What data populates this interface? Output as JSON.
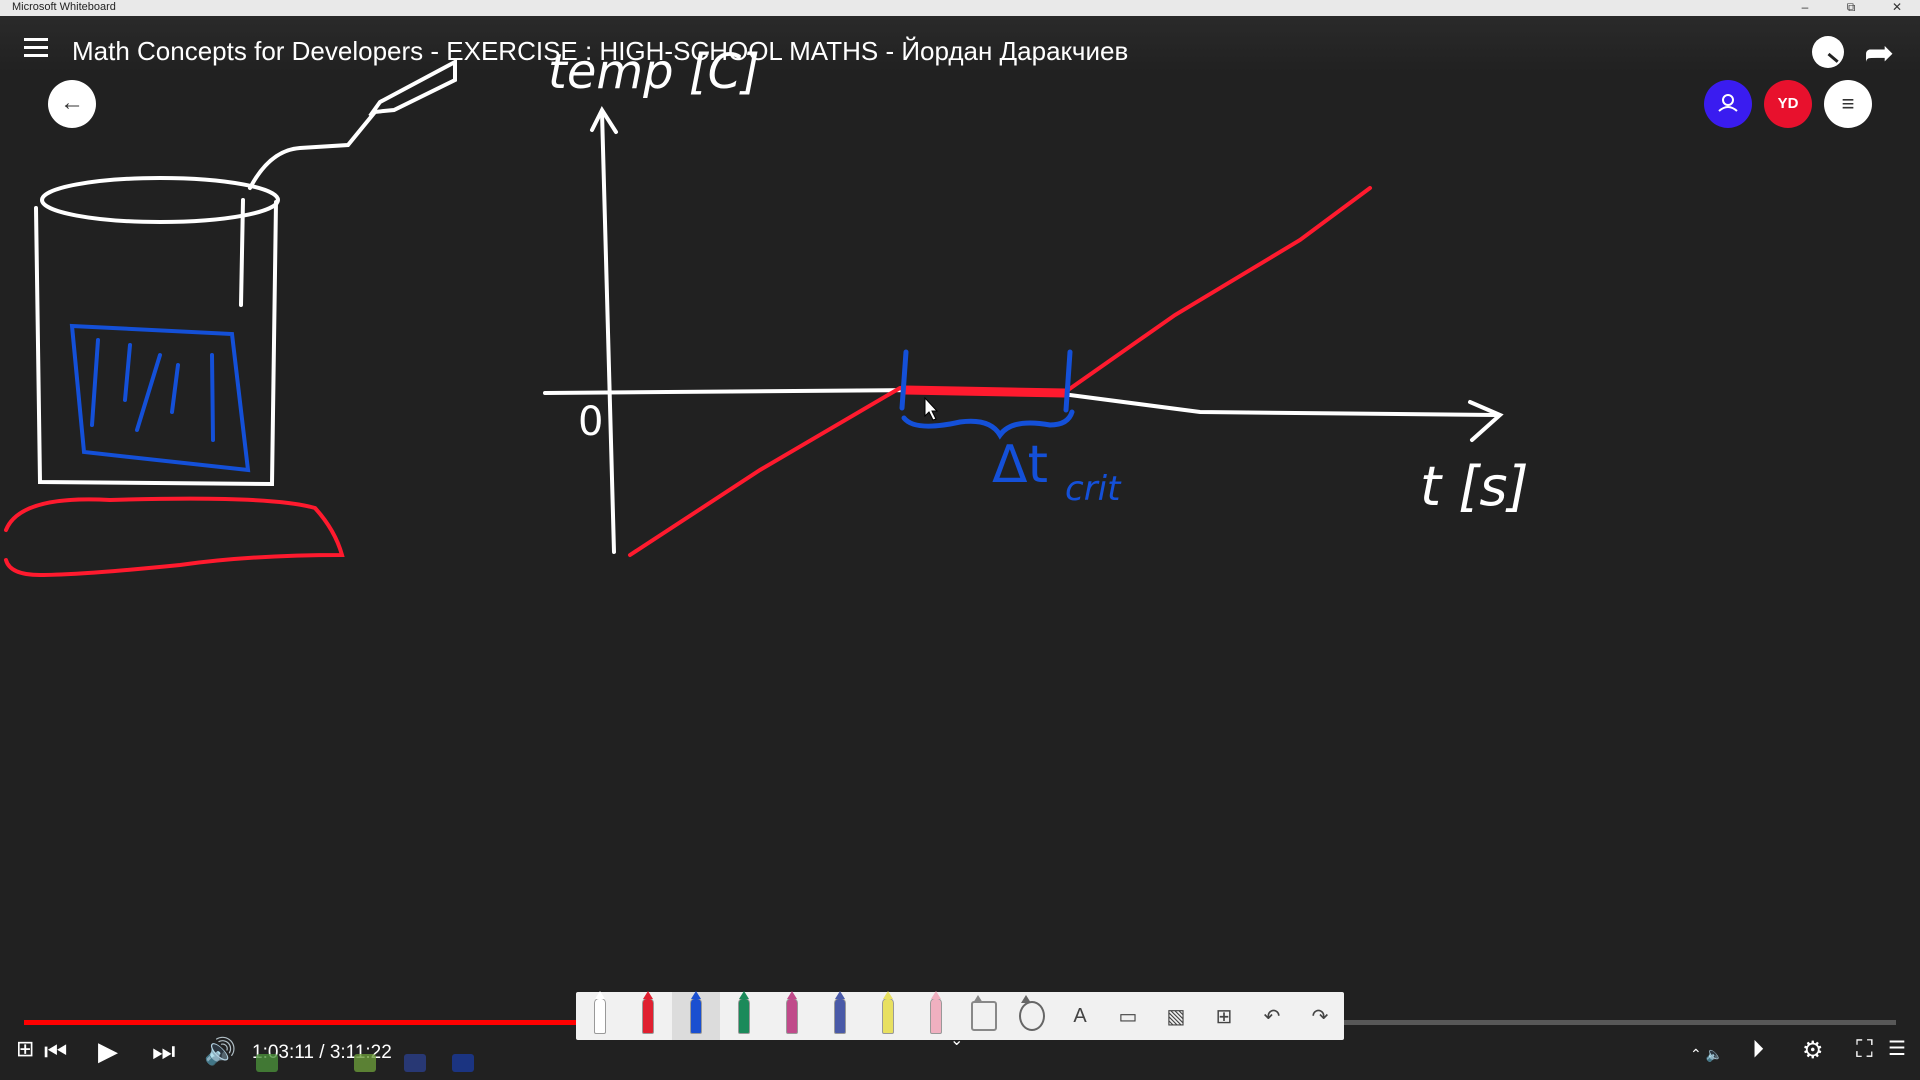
{
  "window": {
    "app_title": "Microsoft Whiteboard",
    "minimize": "–",
    "restore": "⧉",
    "close": "✕"
  },
  "player": {
    "video_title": "Math Concepts for Developers - EXERCISE : HIGH-SCHOOL MATHS - Йордан Даракчиев",
    "time_current": "1:03:11",
    "time_total": "3:11:22",
    "time_display": "1:03:11 / 3:11:22",
    "progress_fraction": 0.33,
    "colors": {
      "played": "#ff0000",
      "accent": "#ff0000"
    }
  },
  "whiteboard": {
    "avatar_initials": "YD",
    "colors": {
      "user_button": "#3a1cf0",
      "avatar": "#e8112d",
      "ink_white": "#ffffff",
      "ink_red": "#ff1a2e",
      "ink_blue": "#1450d8"
    },
    "board_text": {
      "y_axis": "temp [C]",
      "x_axis": "t [s]",
      "origin": "0",
      "delta": "Δt",
      "subscript": "crit"
    },
    "toolbar": [
      {
        "name": "pen-white-icon",
        "color": "#ffffff"
      },
      {
        "name": "pen-red-icon",
        "color": "#e02030"
      },
      {
        "name": "pen-blue-icon",
        "color": "#1a4fd0"
      },
      {
        "name": "pen-green-icon",
        "color": "#1b8a5a"
      },
      {
        "name": "pen-rainbow-icon",
        "color": "#c04a8a"
      },
      {
        "name": "pen-galaxy-icon",
        "color": "#4a5aa8"
      },
      {
        "name": "highlighter-icon",
        "color": "#e8e060"
      },
      {
        "name": "eraser-icon",
        "color": "#f0b0c0"
      },
      {
        "name": "ruler-icon",
        "color": "#888888"
      },
      {
        "name": "lasso-icon",
        "color": "#666666"
      }
    ],
    "toolbar_glyphs": {
      "text": "A",
      "note": "▭",
      "image": "▧",
      "insert": "⊞",
      "undo": "↶",
      "redo": "↷"
    }
  }
}
